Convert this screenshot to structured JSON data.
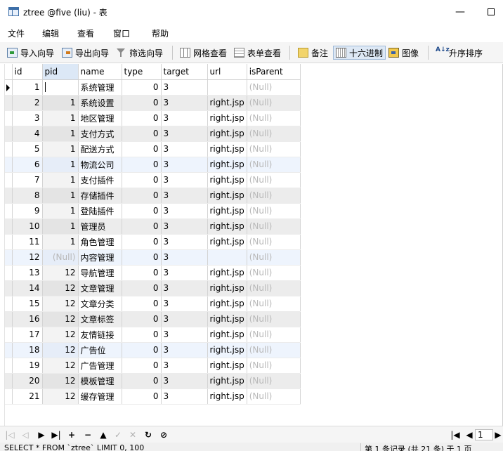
{
  "window": {
    "title": "ztree @five (liu) - 表",
    "minimize": "—",
    "maximize": ""
  },
  "menu": [
    "文件",
    "编辑",
    "查看",
    "窗口",
    "帮助"
  ],
  "toolbar": {
    "import": "导入向导",
    "export": "导出向导",
    "filter": "筛选向导",
    "grid_view": "网格查看",
    "form_view": "表单查看",
    "memo": "备注",
    "hex": "十六进制",
    "image": "图像",
    "sort_asc": "升序排序",
    "sort_icon_glyph": "A↓z"
  },
  "grid": {
    "columns": [
      "id",
      "pid",
      "name",
      "type",
      "target",
      "url",
      "isParent"
    ],
    "rows": [
      {
        "id": "1",
        "pid": "",
        "name": "系统管理",
        "type": "0",
        "target": "3",
        "url": "",
        "isParent": "(Null)"
      },
      {
        "id": "2",
        "pid": "1",
        "name": "系统设置",
        "type": "0",
        "target": "3",
        "url": "right.jsp",
        "isParent": "(Null)"
      },
      {
        "id": "3",
        "pid": "1",
        "name": "地区管理",
        "type": "0",
        "target": "3",
        "url": "right.jsp",
        "isParent": "(Null)"
      },
      {
        "id": "4",
        "pid": "1",
        "name": "支付方式",
        "type": "0",
        "target": "3",
        "url": "right.jsp",
        "isParent": "(Null)"
      },
      {
        "id": "5",
        "pid": "1",
        "name": "配送方式",
        "type": "0",
        "target": "3",
        "url": "right.jsp",
        "isParent": "(Null)"
      },
      {
        "id": "6",
        "pid": "1",
        "name": "物流公司",
        "type": "0",
        "target": "3",
        "url": "right.jsp",
        "isParent": "(Null)"
      },
      {
        "id": "7",
        "pid": "1",
        "name": "支付插件",
        "type": "0",
        "target": "3",
        "url": "right.jsp",
        "isParent": "(Null)"
      },
      {
        "id": "8",
        "pid": "1",
        "name": "存储插件",
        "type": "0",
        "target": "3",
        "url": "right.jsp",
        "isParent": "(Null)"
      },
      {
        "id": "9",
        "pid": "1",
        "name": "登陆插件",
        "type": "0",
        "target": "3",
        "url": "right.jsp",
        "isParent": "(Null)"
      },
      {
        "id": "10",
        "pid": "1",
        "name": "管理员",
        "type": "0",
        "target": "3",
        "url": "right.jsp",
        "isParent": "(Null)"
      },
      {
        "id": "11",
        "pid": "1",
        "name": "角色管理",
        "type": "0",
        "target": "3",
        "url": "right.jsp",
        "isParent": "(Null)"
      },
      {
        "id": "12",
        "pid": "(Null)",
        "name": "内容管理",
        "type": "0",
        "target": "3",
        "url": "",
        "isParent": "(Null)"
      },
      {
        "id": "13",
        "pid": "12",
        "name": "导航管理",
        "type": "0",
        "target": "3",
        "url": "right.jsp",
        "isParent": "(Null)"
      },
      {
        "id": "14",
        "pid": "12",
        "name": "文章管理",
        "type": "0",
        "target": "3",
        "url": "right.jsp",
        "isParent": "(Null)"
      },
      {
        "id": "15",
        "pid": "12",
        "name": "文章分类",
        "type": "0",
        "target": "3",
        "url": "right.jsp",
        "isParent": "(Null)"
      },
      {
        "id": "16",
        "pid": "12",
        "name": "文章标签",
        "type": "0",
        "target": "3",
        "url": "right.jsp",
        "isParent": "(Null)"
      },
      {
        "id": "17",
        "pid": "12",
        "name": "友情链接",
        "type": "0",
        "target": "3",
        "url": "right.jsp",
        "isParent": "(Null)"
      },
      {
        "id": "18",
        "pid": "12",
        "name": "广告位",
        "type": "0",
        "target": "3",
        "url": "right.jsp",
        "isParent": "(Null)"
      },
      {
        "id": "19",
        "pid": "12",
        "name": "广告管理",
        "type": "0",
        "target": "3",
        "url": "right.jsp",
        "isParent": "(Null)"
      },
      {
        "id": "20",
        "pid": "12",
        "name": "模板管理",
        "type": "0",
        "target": "3",
        "url": "right.jsp",
        "isParent": "(Null)"
      },
      {
        "id": "21",
        "pid": "12",
        "name": "缓存管理",
        "type": "0",
        "target": "3",
        "url": "right.jsp",
        "isParent": "(Null)"
      }
    ]
  },
  "navigator": {
    "first": "|◁",
    "prev": "◁",
    "next": "▶",
    "last": "▶|",
    "add": "+",
    "delete": "−",
    "apply": "▲",
    "confirm": "✓",
    "cancel": "✕",
    "refresh": "↻",
    "stop": "⊘",
    "page_first": "|◀",
    "page_prev": "◀",
    "page_next": "▶",
    "page_value": "1"
  },
  "status": {
    "sql": "SELECT * FROM `ztree` LIMIT 0, 1000",
    "record": "第 1 条记录 (共 21 条) 于 1 页"
  }
}
